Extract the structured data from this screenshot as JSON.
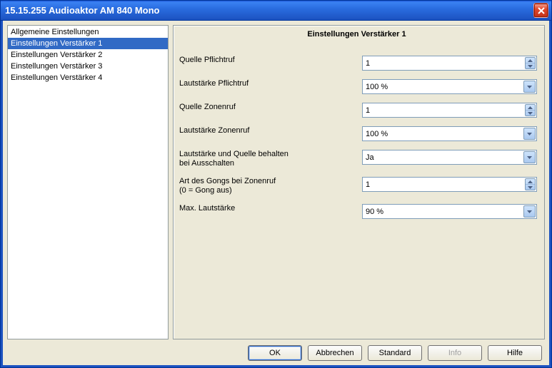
{
  "window": {
    "title": "15.15.255 Audioaktor AM 840 Mono"
  },
  "tree": {
    "items": [
      "Allgemeine Einstellungen",
      "Einstellungen Verstärker 1",
      "Einstellungen Verstärker 2",
      "Einstellungen Verstärker 3",
      "Einstellungen Verstärker 4"
    ],
    "selected_index": 1
  },
  "panel": {
    "title": "Einstellungen Verstärker 1",
    "fields": [
      {
        "label": "Quelle Pflichtruf",
        "value": "1",
        "type": "spin"
      },
      {
        "label": "Lautstärke Pflichtruf",
        "value": "100 %",
        "type": "dropdown"
      },
      {
        "label": "Quelle Zonenruf",
        "value": "1",
        "type": "spin"
      },
      {
        "label": "Lautstärke Zonenruf",
        "value": "100 %",
        "type": "dropdown"
      },
      {
        "label": "Lautstärke und Quelle behalten\nbei Ausschalten",
        "value": "Ja",
        "type": "dropdown"
      },
      {
        "label": "Art des Gongs bei Zonenruf\n(0 = Gong aus)",
        "value": "1",
        "type": "spin"
      },
      {
        "label": "Max. Lautstärke",
        "value": "90 %",
        "type": "dropdown"
      }
    ]
  },
  "buttons": {
    "ok": "OK",
    "cancel": "Abbrechen",
    "standard": "Standard",
    "info": "Info",
    "help": "Hilfe"
  }
}
